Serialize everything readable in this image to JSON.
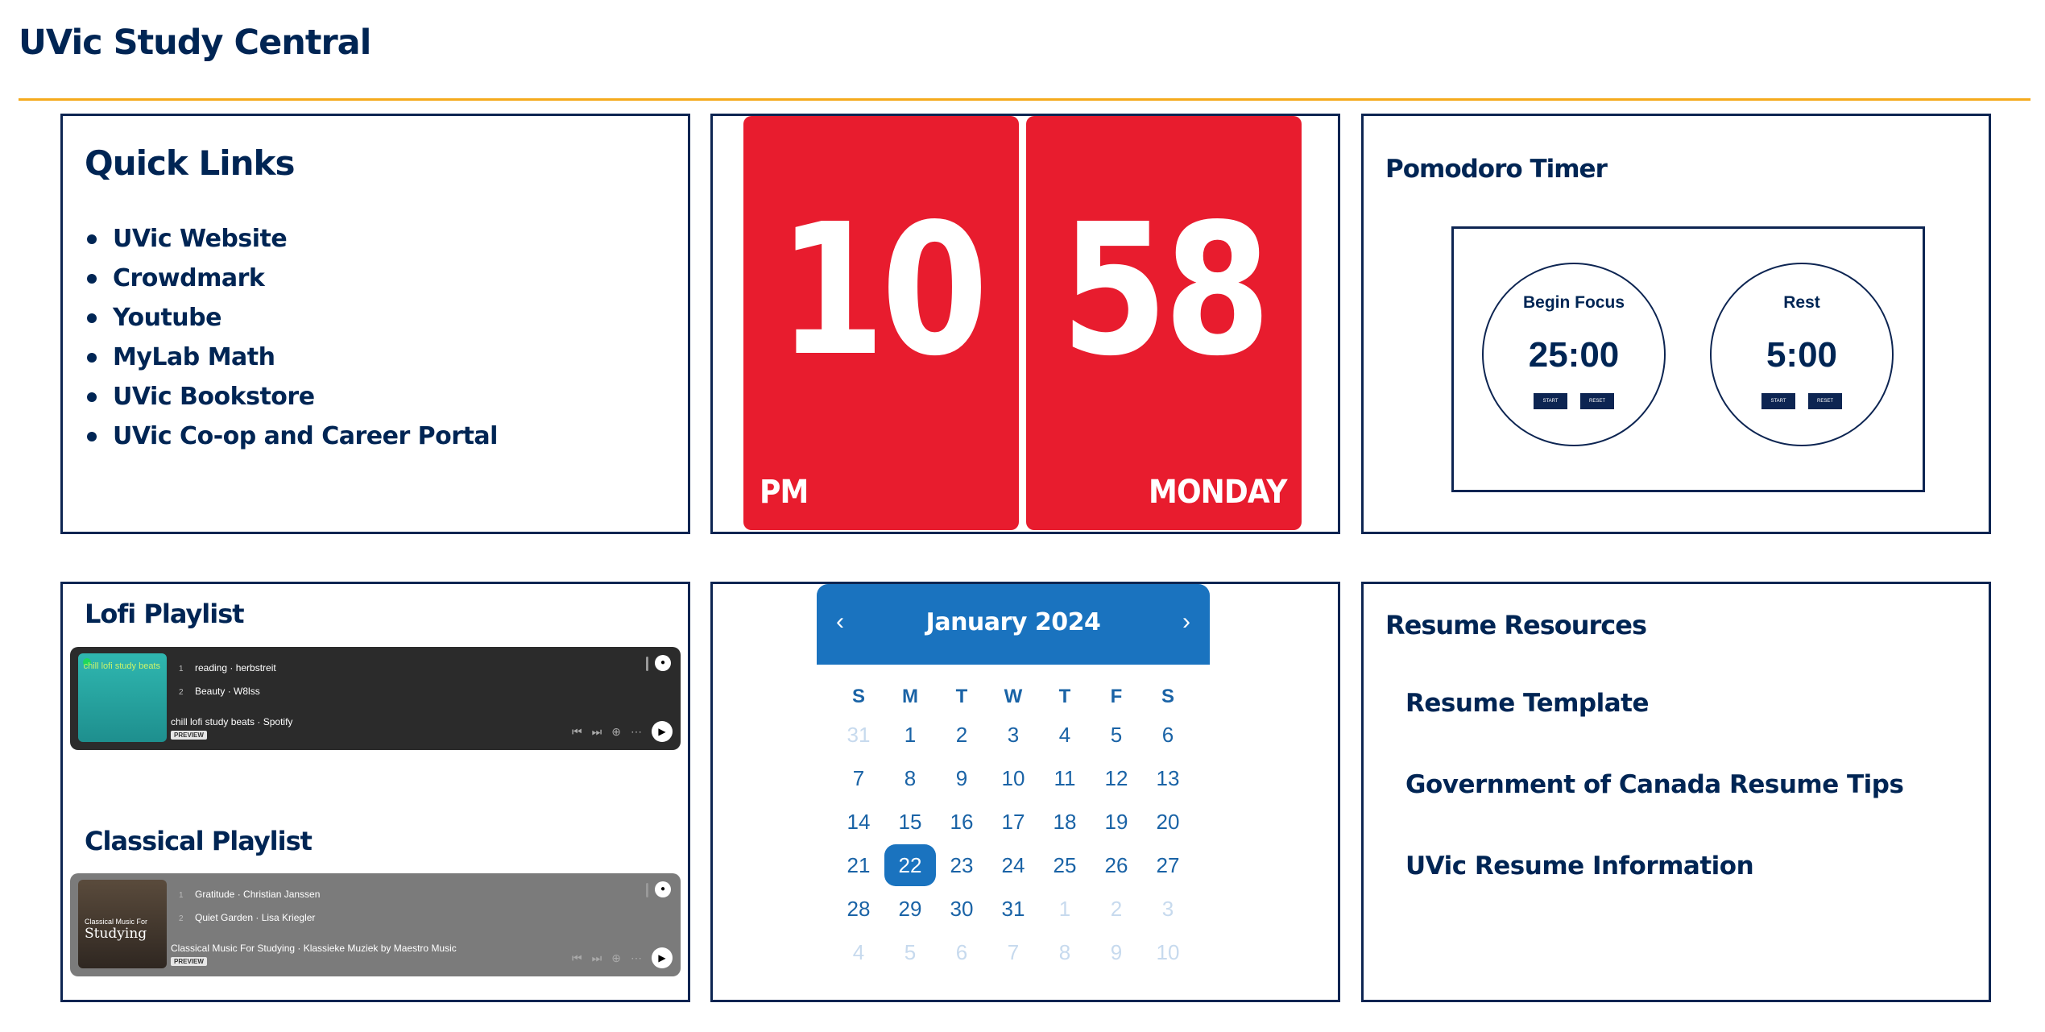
{
  "site": {
    "title": "UVic Study Central",
    "accent": "#f5aa1c",
    "navy": "#002554"
  },
  "quick_links": {
    "title": "Quick Links",
    "items": [
      "UVic Website",
      "Crowdmark",
      "Youtube",
      "MyLab Math",
      "UVic Bookstore",
      "UVic Co-op and Career Portal"
    ]
  },
  "clock": {
    "hours": "10",
    "minutes": "58",
    "meridiem": "PM",
    "weekday": "MONDAY",
    "color": "#e81c2e"
  },
  "pomodoro": {
    "title": "Pomodoro Timer",
    "focus": {
      "label": "Begin Focus",
      "time": "25:00",
      "start": "START",
      "reset": "RESET"
    },
    "rest": {
      "label": "Rest",
      "time": "5:00",
      "start": "START",
      "reset": "RESET"
    }
  },
  "music": {
    "lofi": {
      "heading": "Lofi Playlist",
      "art_text": "chill lofi study beats",
      "tracks": [
        {
          "num": "1",
          "title": "reading · herbstreit"
        },
        {
          "num": "2",
          "title": "Beauty · W8lss"
        }
      ],
      "playlist_title": "chill lofi study beats · Spotify",
      "preview": "PREVIEW"
    },
    "classical": {
      "heading": "Classical Playlist",
      "art_small": "Classical Music For",
      "art_big": "Studying",
      "tracks": [
        {
          "num": "1",
          "title": "Gratitude · Christian Janssen"
        },
        {
          "num": "2",
          "title": "Quiet Garden · Lisa Kriegler"
        }
      ],
      "playlist_title": "Classical Music For Studying · Klassieke Muziek by Maestro Music",
      "preview": "PREVIEW"
    }
  },
  "calendar": {
    "month": "January 2024",
    "prev": "‹",
    "next": "›",
    "weekdays": [
      "S",
      "M",
      "T",
      "W",
      "T",
      "F",
      "S"
    ],
    "selected": "22",
    "days": [
      [
        "31",
        "1",
        "2",
        "3",
        "4",
        "5",
        "6"
      ],
      [
        "7",
        "8",
        "9",
        "10",
        "11",
        "12",
        "13"
      ],
      [
        "14",
        "15",
        "16",
        "17",
        "18",
        "19",
        "20"
      ],
      [
        "21",
        "22",
        "23",
        "24",
        "25",
        "26",
        "27"
      ],
      [
        "28",
        "29",
        "30",
        "31",
        "1",
        "2",
        "3"
      ],
      [
        "4",
        "5",
        "6",
        "7",
        "8",
        "9",
        "10"
      ]
    ],
    "dim_before": 1,
    "dim_after_index": 32
  },
  "resume": {
    "title": "Resume Resources",
    "links": [
      "Resume Template",
      "Government of Canada Resume Tips",
      "UVic Resume Information"
    ]
  }
}
